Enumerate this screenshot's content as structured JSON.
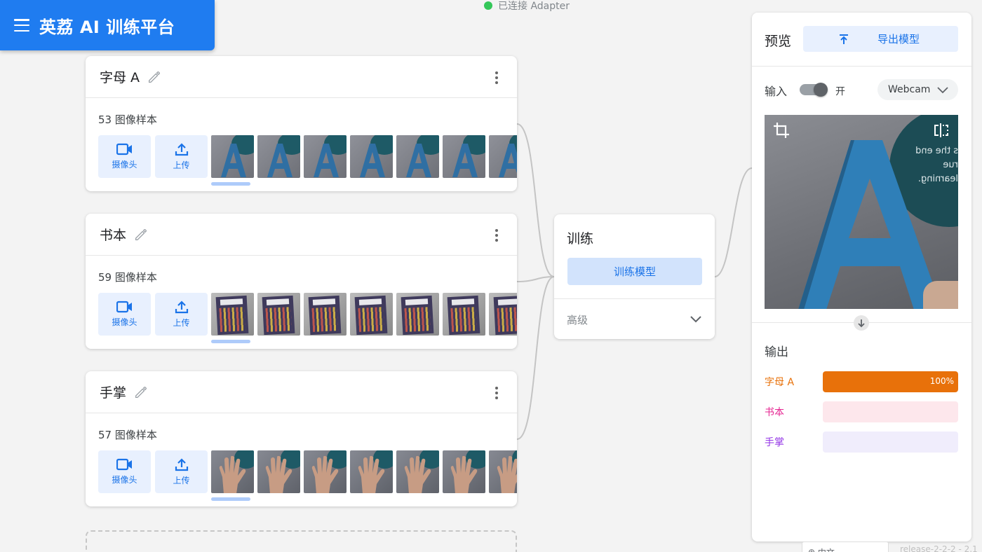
{
  "app": {
    "title": "英荔 AI 训练平台"
  },
  "status": {
    "text": "已连接 Adapter",
    "color": "#34c759"
  },
  "classes": [
    {
      "name": "字母 A",
      "count_text": "53 图像样本",
      "thumb_kind": "letter-a"
    },
    {
      "name": "书本",
      "count_text": "59 图像样本",
      "thumb_kind": "book"
    },
    {
      "name": "手掌",
      "count_text": "57 图像样本",
      "thumb_kind": "hand"
    }
  ],
  "class_tools": {
    "webcam_label": "摄像头",
    "upload_label": "上传"
  },
  "training": {
    "title": "训练",
    "train_button": "训练模型",
    "advanced_label": "高级"
  },
  "preview": {
    "title": "预览",
    "export_button": "导出模型",
    "input_label": "输入",
    "input_toggle_state": "开",
    "input_on": true,
    "source_select": "Webcam",
    "camera_overlay_text": [
      "s the end",
      "rue learning."
    ],
    "output_label": "输出",
    "outputs": [
      {
        "name": "字母 A",
        "confidence": 1.0,
        "pct_text": "100%",
        "color": "#e8710a",
        "track": "#fde3cf"
      },
      {
        "name": "书本",
        "confidence": 0.0,
        "pct_text": "",
        "color": "#e52592",
        "track": "#fde7ec"
      },
      {
        "name": "手掌",
        "confidence": 0.0,
        "pct_text": "",
        "color": "#9334e6",
        "track": "#f0edfc"
      }
    ]
  },
  "footer": {
    "language": "中文",
    "release": "release-2-2-2 - 2.1"
  },
  "colors": {
    "brand": "#1f7cf0",
    "accent_light": "#e8f0fe",
    "train_button": "#d2e3fc"
  }
}
